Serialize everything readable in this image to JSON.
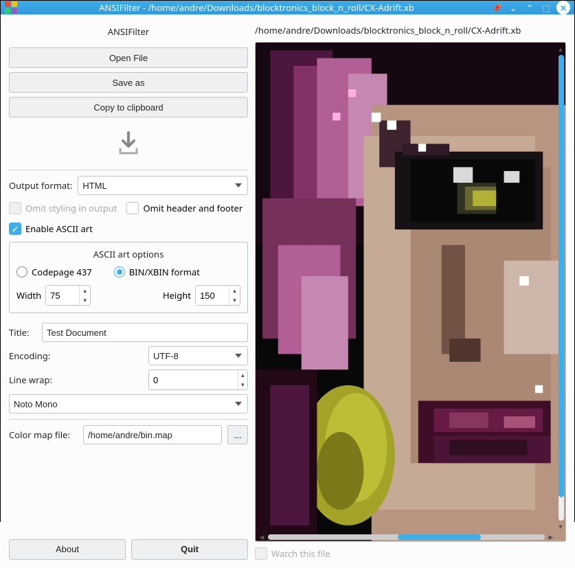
{
  "titlebar": {
    "title": "ANSIFilter - /home/andre/Downloads/blocktronics_block_n_roll/CX-Adrift.xb"
  },
  "left": {
    "app_title": "ANSIFilter",
    "open_file": "Open File",
    "save_as": "Save as",
    "copy_clipboard": "Copy to clipboard",
    "output_format_label": "Output format:",
    "output_format_value": "HTML",
    "omit_styling": "Omit styling in output",
    "omit_header": "Omit header and footer",
    "enable_ascii": "Enable ASCII art",
    "ascii_group_title": "ASCII art options",
    "codepage_label": "Codepage 437",
    "binxbin_label": "BIN/XBIN format",
    "width_label": "Width",
    "width_value": "75",
    "height_label": "Height",
    "height_value": "150",
    "title_label": "Title:",
    "title_value": "Test Document",
    "encoding_label": "Encoding:",
    "encoding_value": "UTF-8",
    "linewrap_label": "Line wrap:",
    "linewrap_value": "0",
    "font_value": "Noto Mono",
    "colormap_label": "Color map file:",
    "colormap_value": "/home/andre/bin.map",
    "browse": "...",
    "about": "About",
    "quit": "Quit"
  },
  "right": {
    "filepath": "/home/andre/Downloads/blocktronics_block_n_roll/CX-Adrift.xb",
    "watch_label": "Watch this file"
  }
}
